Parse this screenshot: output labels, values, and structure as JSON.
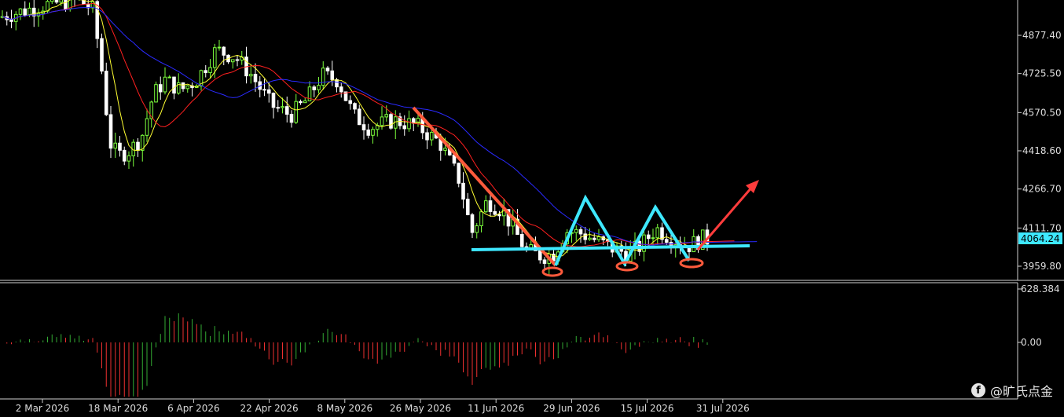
{
  "chart_data": {
    "type": "candlestick",
    "instrument_panel": {
      "y_ticks": [
        "4877.40",
        "4725.50",
        "4570.50",
        "4418.60",
        "4266.70",
        "4111.70",
        "3959.80"
      ],
      "ylim": [
        3900,
        5050
      ],
      "current_price": "4064.24",
      "current_price_value": 4064.24
    },
    "oscillator_panel": {
      "y_ticks": [
        "628.384",
        "0.00"
      ],
      "ylim": [
        -700,
        700
      ]
    },
    "x_ticks": [
      "2 Mar 2026",
      "18 Mar 2026",
      "6 Apr 2026",
      "22 Apr 2026",
      "8 May 2026",
      "26 May 2026",
      "11 Jun 2026",
      "29 Jun 2026",
      "15 Jul 2026",
      "31 Jul 2026"
    ],
    "moving_averages": [
      "yellow",
      "red",
      "blue"
    ],
    "pattern": "triple bottom with neckline and breakout arrow"
  },
  "watermark": {
    "icon": "facebook-icon",
    "text": "@旷氏点金"
  },
  "colors": {
    "background": "#000000",
    "bull": "#7cff3c",
    "bear": "#ffffff",
    "ma_fast": "#ffff33",
    "ma_mid": "#ff2020",
    "ma_slow": "#2a2aff",
    "pattern": "#3ee8ff",
    "arrow": "#ff5a3c",
    "osc_pos": "#33aa33",
    "osc_neg": "#ee3030"
  }
}
